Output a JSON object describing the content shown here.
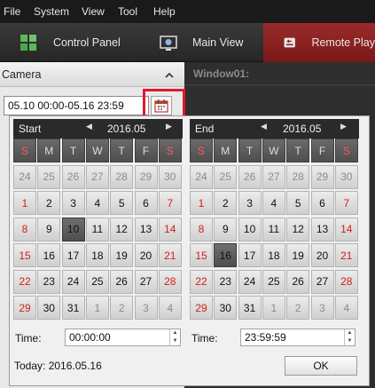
{
  "menu": [
    "File",
    "System",
    "View",
    "Tool",
    "Help"
  ],
  "tabs": [
    {
      "label": "Control Panel",
      "icon": "control-panel-icon"
    },
    {
      "label": "Main View",
      "icon": "main-view-icon"
    },
    {
      "label": "Remote Play",
      "icon": "remote-play-icon",
      "active": true
    }
  ],
  "camera_panel": {
    "title": "Camera",
    "date_range": "05.10 00:00-05.16 23:59"
  },
  "window_label": "Window01:",
  "weekdays": [
    "S",
    "M",
    "T",
    "W",
    "T",
    "F",
    "S"
  ],
  "start": {
    "label": "Start",
    "month": "2016.05",
    "weeks": [
      [
        "24",
        "25",
        "26",
        "27",
        "28",
        "29",
        "30"
      ],
      [
        "1",
        "2",
        "3",
        "4",
        "5",
        "6",
        "7"
      ],
      [
        "8",
        "9",
        "10",
        "11",
        "12",
        "13",
        "14"
      ],
      [
        "15",
        "16",
        "17",
        "18",
        "19",
        "20",
        "21"
      ],
      [
        "22",
        "23",
        "24",
        "25",
        "26",
        "27",
        "28"
      ],
      [
        "29",
        "30",
        "31",
        "1",
        "2",
        "3",
        "4"
      ]
    ],
    "selected_day": "10",
    "time_label": "Time:",
    "time": "00:00:00"
  },
  "end": {
    "label": "End",
    "month": "2016.05",
    "weeks": [
      [
        "24",
        "25",
        "26",
        "27",
        "28",
        "29",
        "30"
      ],
      [
        "1",
        "2",
        "3",
        "4",
        "5",
        "6",
        "7"
      ],
      [
        "8",
        "9",
        "10",
        "11",
        "12",
        "13",
        "14"
      ],
      [
        "15",
        "16",
        "17",
        "18",
        "19",
        "20",
        "21"
      ],
      [
        "22",
        "23",
        "24",
        "25",
        "26",
        "27",
        "28"
      ],
      [
        "29",
        "30",
        "31",
        "1",
        "2",
        "3",
        "4"
      ]
    ],
    "selected_day": "16",
    "time_label": "Time:",
    "time": "23:59:59"
  },
  "today": "Today: 2016.05.16",
  "ok_label": "OK",
  "colors": {
    "accent_red": "#e0192b",
    "weekend_red": "#d21e1e",
    "active_tab": "#8a1f1f"
  }
}
